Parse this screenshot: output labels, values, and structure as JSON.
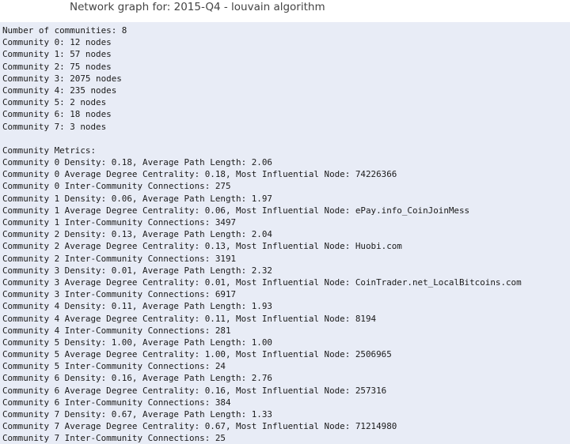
{
  "header": {
    "title": "Network graph for: 2015-Q4 - louvain algorithm"
  },
  "output": {
    "lines": [
      "Number of communities: 8",
      "Community 0: 12 nodes",
      "Community 1: 57 nodes",
      "Community 2: 75 nodes",
      "Community 3: 2075 nodes",
      "Community 4: 235 nodes",
      "Community 5: 2 nodes",
      "Community 6: 18 nodes",
      "Community 7: 3 nodes",
      "",
      "Community Metrics:",
      "Community 0 Density: 0.18, Average Path Length: 2.06",
      "Community 0 Average Degree Centrality: 0.18, Most Influential Node: 74226366",
      "Community 0 Inter-Community Connections: 275",
      "Community 1 Density: 0.06, Average Path Length: 1.97",
      "Community 1 Average Degree Centrality: 0.06, Most Influential Node: ePay.info_CoinJoinMess",
      "Community 1 Inter-Community Connections: 3497",
      "Community 2 Density: 0.13, Average Path Length: 2.04",
      "Community 2 Average Degree Centrality: 0.13, Most Influential Node: Huobi.com",
      "Community 2 Inter-Community Connections: 3191",
      "Community 3 Density: 0.01, Average Path Length: 2.32",
      "Community 3 Average Degree Centrality: 0.01, Most Influential Node: CoinTrader.net_LocalBitcoins.com",
      "Community 3 Inter-Community Connections: 6917",
      "Community 4 Density: 0.11, Average Path Length: 1.93",
      "Community 4 Average Degree Centrality: 0.11, Most Influential Node: 8194",
      "Community 4 Inter-Community Connections: 281",
      "Community 5 Density: 1.00, Average Path Length: 1.00",
      "Community 5 Average Degree Centrality: 1.00, Most Influential Node: 2506965",
      "Community 5 Inter-Community Connections: 24",
      "Community 6 Density: 0.16, Average Path Length: 2.76",
      "Community 6 Average Degree Centrality: 0.16, Most Influential Node: 257316",
      "Community 6 Inter-Community Connections: 384",
      "Community 7 Density: 0.67, Average Path Length: 1.33",
      "Community 7 Average Degree Centrality: 0.67, Most Influential Node: 71214980",
      "Community 7 Inter-Community Connections: 25"
    ]
  }
}
